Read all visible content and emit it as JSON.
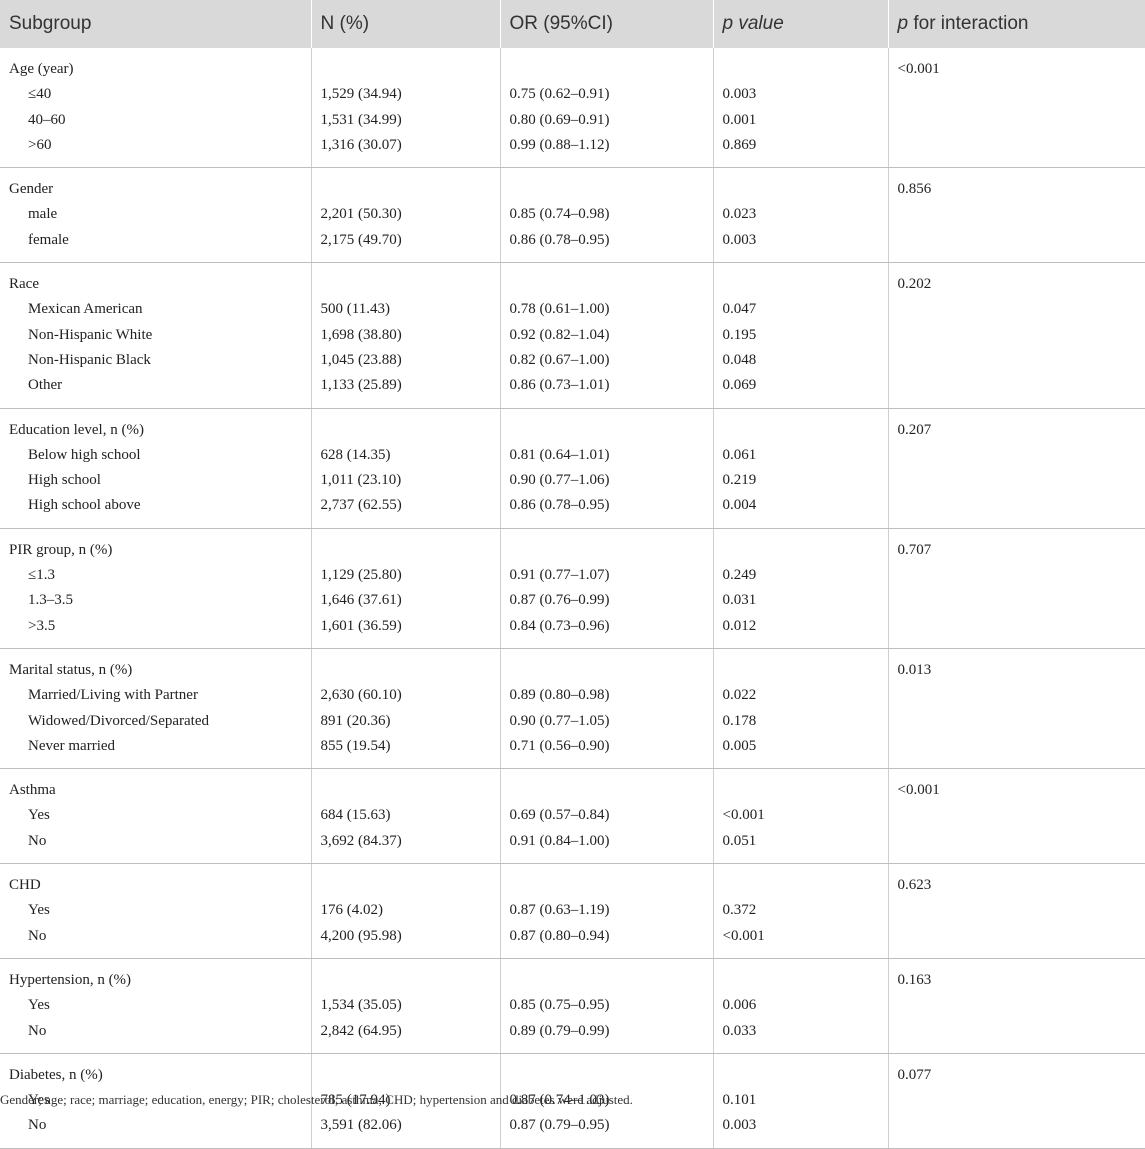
{
  "headers": {
    "subgroup": "Subgroup",
    "n": "N (%)",
    "or": "OR (95%CI)",
    "p_value_p": "p",
    "p_value_rest": " value",
    "p_inter_p": "p",
    "p_inter_rest": " for interaction"
  },
  "groups": [
    {
      "label": "Age (year)",
      "interaction": "<0.001",
      "rows": [
        {
          "label": "≤40",
          "n": "1,529 (34.94)",
          "or": "0.75 (0.62–0.91)",
          "p": "0.003"
        },
        {
          "label": "40–60",
          "n": "1,531 (34.99)",
          "or": "0.80 (0.69–0.91)",
          "p": "0.001"
        },
        {
          "label": ">60",
          "n": "1,316 (30.07)",
          "or": "0.99 (0.88–1.12)",
          "p": "0.869"
        }
      ]
    },
    {
      "label": "Gender",
      "interaction": "0.856",
      "rows": [
        {
          "label": "male",
          "n": "2,201 (50.30)",
          "or": "0.85 (0.74–0.98)",
          "p": "0.023"
        },
        {
          "label": "female",
          "n": "2,175 (49.70)",
          "or": "0.86 (0.78–0.95)",
          "p": "0.003"
        }
      ]
    },
    {
      "label": "Race",
      "interaction": "0.202",
      "rows": [
        {
          "label": "Mexican American",
          "n": "500 (11.43)",
          "or": "0.78 (0.61–1.00)",
          "p": "0.047"
        },
        {
          "label": "Non-Hispanic White",
          "n": "1,698 (38.80)",
          "or": "0.92 (0.82–1.04)",
          "p": "0.195"
        },
        {
          "label": "Non-Hispanic Black",
          "n": "1,045 (23.88)",
          "or": "0.82 (0.67–1.00)",
          "p": "0.048"
        },
        {
          "label": "Other",
          "n": "1,133 (25.89)",
          "or": "0.86 (0.73–1.01)",
          "p": "0.069"
        }
      ]
    },
    {
      "label": "Education level, n (%)",
      "interaction": "0.207",
      "rows": [
        {
          "label": "Below high school",
          "n": "628 (14.35)",
          "or": "0.81 (0.64–1.01)",
          "p": "0.061"
        },
        {
          "label": "High school",
          "n": "1,011 (23.10)",
          "or": "0.90 (0.77–1.06)",
          "p": "0.219"
        },
        {
          "label": "High school above",
          "n": "2,737 (62.55)",
          "or": "0.86 (0.78–0.95)",
          "p": "0.004"
        }
      ]
    },
    {
      "label": "PIR group, n (%)",
      "interaction": "0.707",
      "rows": [
        {
          "label": "≤1.3",
          "n": "1,129 (25.80)",
          "or": "0.91 (0.77–1.07)",
          "p": "0.249"
        },
        {
          "label": "1.3–3.5",
          "n": "1,646 (37.61)",
          "or": "0.87 (0.76–0.99)",
          "p": "0.031"
        },
        {
          "label": ">3.5",
          "n": "1,601 (36.59)",
          "or": "0.84 (0.73–0.96)",
          "p": "0.012"
        }
      ]
    },
    {
      "label": "Marital status, n (%)",
      "interaction": "0.013",
      "rows": [
        {
          "label": "Married/Living with Partner",
          "n": "2,630 (60.10)",
          "or": "0.89 (0.80–0.98)",
          "p": "0.022"
        },
        {
          "label": "Widowed/Divorced/Separated",
          "n": "891 (20.36)",
          "or": "0.90 (0.77–1.05)",
          "p": "0.178"
        },
        {
          "label": "Never married",
          "n": "855 (19.54)",
          "or": "0.71 (0.56–0.90)",
          "p": "0.005"
        }
      ]
    },
    {
      "label": "Asthma",
      "interaction": "<0.001",
      "rows": [
        {
          "label": "Yes",
          "n": "684 (15.63)",
          "or": "0.69 (0.57–0.84)",
          "p": "<0.001"
        },
        {
          "label": "No",
          "n": "3,692 (84.37)",
          "or": "0.91 (0.84–1.00)",
          "p": "0.051"
        }
      ]
    },
    {
      "label": "CHD",
      "interaction": "0.623",
      "rows": [
        {
          "label": "Yes",
          "n": "176 (4.02)",
          "or": "0.87 (0.63–1.19)",
          "p": "0.372"
        },
        {
          "label": "No",
          "n": "4,200 (95.98)",
          "or": "0.87 (0.80–0.94)",
          "p": "<0.001"
        }
      ]
    },
    {
      "label": "Hypertension, n (%)",
      "interaction": "0.163",
      "rows": [
        {
          "label": "Yes",
          "n": "1,534 (35.05)",
          "or": "0.85 (0.75–0.95)",
          "p": "0.006"
        },
        {
          "label": "No",
          "n": "2,842 (64.95)",
          "or": "0.89 (0.79–0.99)",
          "p": "0.033"
        }
      ]
    },
    {
      "label": "Diabetes, n (%)",
      "interaction": "0.077",
      "rows": [
        {
          "label": "Yes",
          "n": "785 (17.94)",
          "or": "0.87 (0.74–1.03)",
          "p": "0.101"
        },
        {
          "label": "No",
          "n": "3,591 (82.06)",
          "or": "0.87 (0.79–0.95)",
          "p": "0.003"
        }
      ]
    }
  ],
  "footnote": "Gender; age; race; marriage; education, energy; PIR; cholesterol; asthma; CHD; hypertension and diabetes were adjusted."
}
